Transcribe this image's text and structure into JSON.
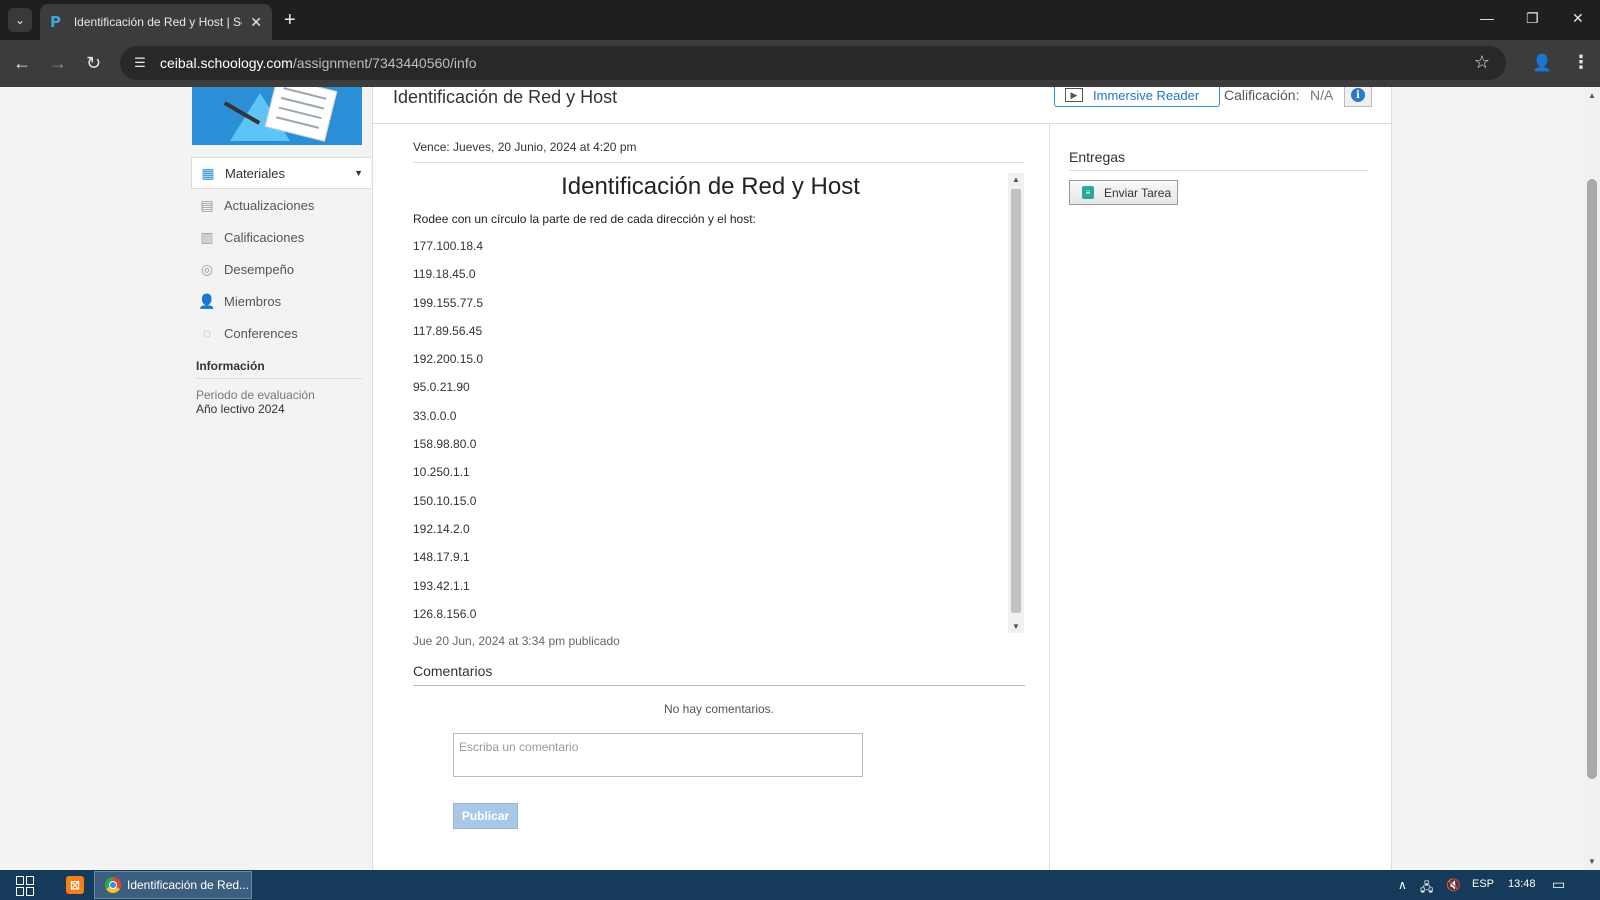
{
  "browser": {
    "tab_title": "Identificación de Red y Host | Sc",
    "url_host": "ceibal.schoology.com",
    "url_path": "/assignment/7343440560/info"
  },
  "sidebar": {
    "items": [
      {
        "label": "Materiales",
        "icon": "materials-icon",
        "active": true
      },
      {
        "label": "Actualizaciones",
        "icon": "updates-icon"
      },
      {
        "label": "Calificaciones",
        "icon": "grades-icon"
      },
      {
        "label": "Desempeño",
        "icon": "performance-icon"
      },
      {
        "label": "Miembros",
        "icon": "members-icon"
      },
      {
        "label": "Conferences",
        "icon": "conferences-icon"
      }
    ],
    "info_title": "Información",
    "grading_period_label": "Periodo de evaluación",
    "grading_period_value": "Año lectivo 2024"
  },
  "header": {
    "title": "Identificación de Red y Host",
    "immersive_reader": "Immersive Reader",
    "grade_label": "Calificación:",
    "grade_value": "N/A"
  },
  "assignment": {
    "due": "Vence: Jueves, 20 Junio, 2024 at 4:20 pm",
    "doc_title": "Identificación de Red y Host",
    "instruction": "Rodee con un círculo la parte de red de cada dirección y el host:",
    "addresses": [
      "177.100.18.4",
      "119.18.45.0",
      "199.155.77.5",
      "117.89.56.45",
      "192.200.15.0",
      "95.0.21.90",
      "33.0.0.0",
      "158.98.80.0",
      "10.250.1.1",
      "150.10.15.0",
      "192.14.2.0",
      "148.17.9.1",
      "193.42.1.1",
      "126.8.156.0"
    ],
    "published": "Jue 20 Jun, 2024 at 3:34 pm publicado"
  },
  "comments": {
    "title": "Comentarios",
    "empty": "No hay comentarios.",
    "placeholder": "Escriba un comentario",
    "publish": "Publicar"
  },
  "submissions": {
    "title": "Entregas",
    "submit": "Enviar Tarea"
  },
  "taskbar": {
    "window_label": "Identificación de Red...",
    "language": "ESP",
    "time": "13:48"
  }
}
